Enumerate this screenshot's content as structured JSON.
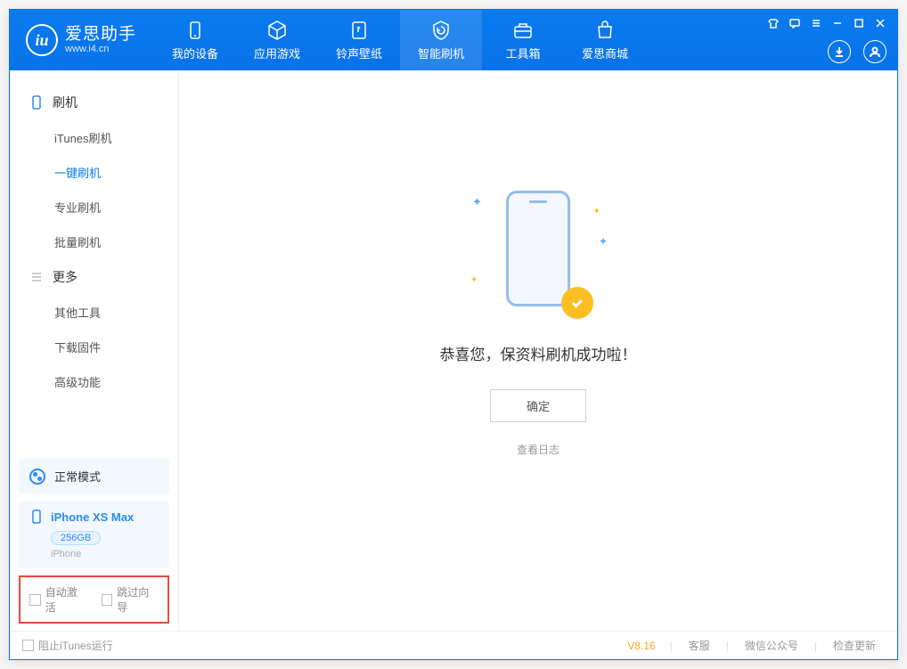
{
  "app": {
    "name": "爱思助手",
    "website": "www.i4.cn"
  },
  "tabs": [
    {
      "label": "我的设备",
      "icon": "device"
    },
    {
      "label": "应用游戏",
      "icon": "cube"
    },
    {
      "label": "铃声壁纸",
      "icon": "music"
    },
    {
      "label": "智能刷机",
      "icon": "shield"
    },
    {
      "label": "工具箱",
      "icon": "toolbox"
    },
    {
      "label": "爱思商城",
      "icon": "shop"
    }
  ],
  "sidebar": {
    "group1": {
      "title": "刷机"
    },
    "items1": [
      {
        "label": "iTunes刷机"
      },
      {
        "label": "一键刷机"
      },
      {
        "label": "专业刷机"
      },
      {
        "label": "批量刷机"
      }
    ],
    "group2": {
      "title": "更多"
    },
    "items2": [
      {
        "label": "其他工具"
      },
      {
        "label": "下载固件"
      },
      {
        "label": "高级功能"
      }
    ],
    "mode": "正常模式",
    "device": {
      "name": "iPhone XS Max",
      "capacity": "256GB",
      "type": "iPhone"
    },
    "checkbox1": "自动激活",
    "checkbox2": "跳过向导"
  },
  "main": {
    "success_text": "恭喜您，保资料刷机成功啦！",
    "confirm_btn": "确定",
    "log_link": "查看日志"
  },
  "statusbar": {
    "stop_itunes": "阻止iTunes运行",
    "version": "V8.16",
    "link1": "客服",
    "link2": "微信公众号",
    "link3": "检查更新"
  }
}
